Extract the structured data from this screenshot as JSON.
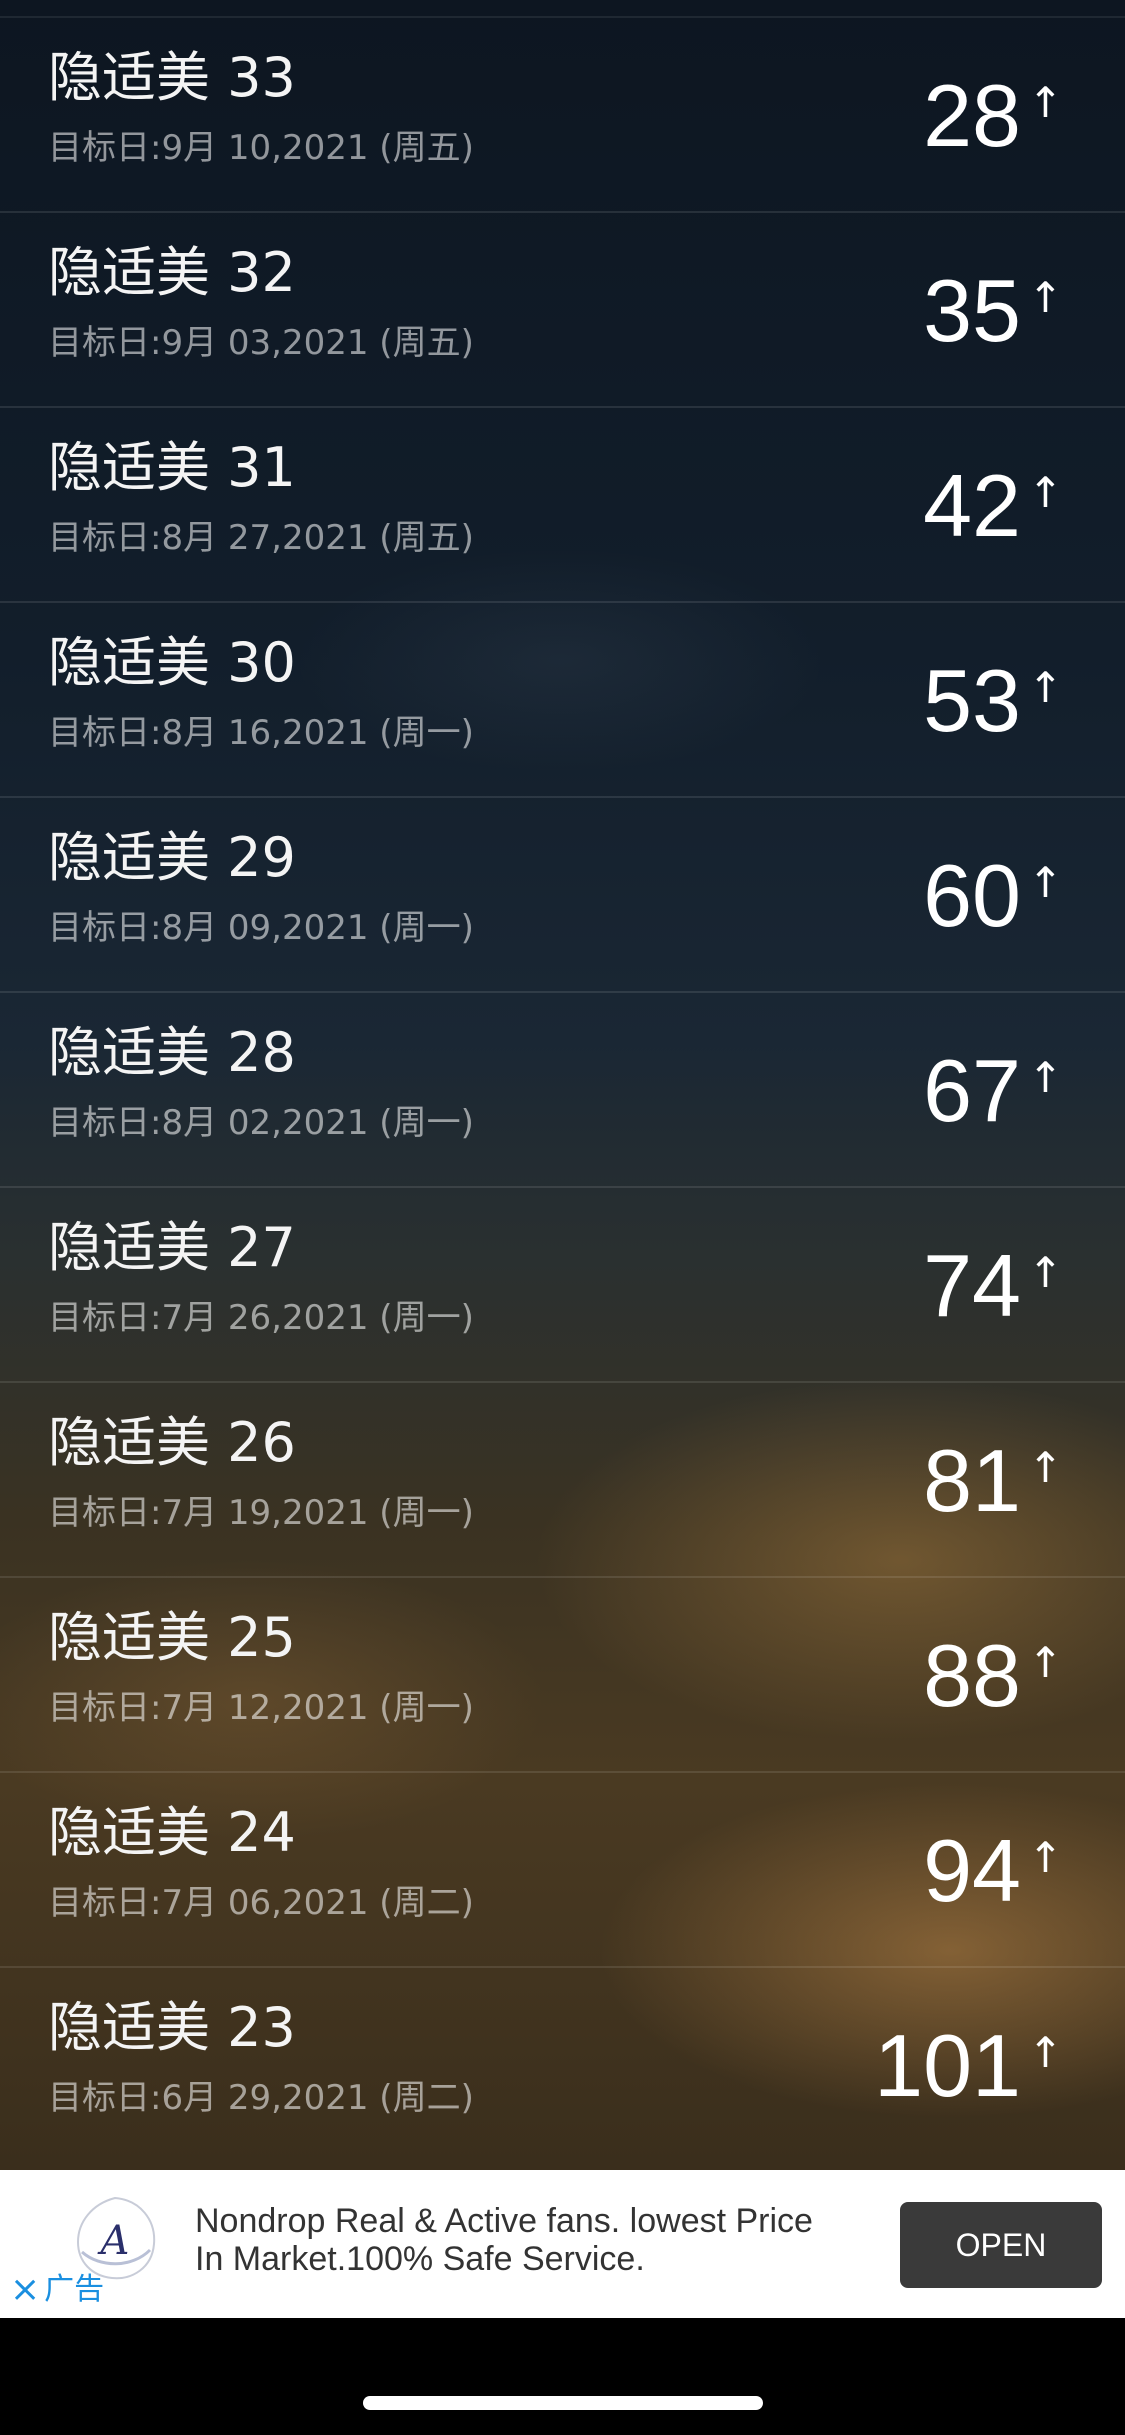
{
  "rows": [
    {
      "title": "隐适美 33",
      "subtitle": "目标日:9月 10,2021 (周五)",
      "count": "28",
      "arrow": "↑"
    },
    {
      "title": "隐适美 32",
      "subtitle": "目标日:9月 03,2021 (周五)",
      "count": "35",
      "arrow": "↑"
    },
    {
      "title": "隐适美 31",
      "subtitle": "目标日:8月 27,2021 (周五)",
      "count": "42",
      "arrow": "↑"
    },
    {
      "title": "隐适美 30",
      "subtitle": "目标日:8月 16,2021 (周一)",
      "count": "53",
      "arrow": "↑"
    },
    {
      "title": "隐适美 29",
      "subtitle": "目标日:8月 09,2021 (周一)",
      "count": "60",
      "arrow": "↑"
    },
    {
      "title": "隐适美 28",
      "subtitle": "目标日:8月 02,2021 (周一)",
      "count": "67",
      "arrow": "↑"
    },
    {
      "title": "隐适美 27",
      "subtitle": "目标日:7月 26,2021 (周一)",
      "count": "74",
      "arrow": "↑"
    },
    {
      "title": "隐适美 26",
      "subtitle": "目标日:7月 19,2021 (周一)",
      "count": "81",
      "arrow": "↑"
    },
    {
      "title": "隐适美 25",
      "subtitle": "目标日:7月 12,2021 (周一)",
      "count": "88",
      "arrow": "↑"
    },
    {
      "title": "隐适美 24",
      "subtitle": "目标日:7月 06,2021 (周二)",
      "count": "94",
      "arrow": "↑"
    },
    {
      "title": "隐适美 23",
      "subtitle": "目标日:6月 29,2021 (周二)",
      "count": "101",
      "arrow": "↑"
    }
  ],
  "ad": {
    "text": "Nondrop Real & Active fans. lowest Price In Market.100% Safe Service.",
    "open_label": "OPEN",
    "close_icon": "×",
    "close_label": "广告",
    "logo_letter": "A"
  },
  "colors": {
    "ad_button": "#3a3a3a",
    "ad_close": "#1a8fe0"
  }
}
